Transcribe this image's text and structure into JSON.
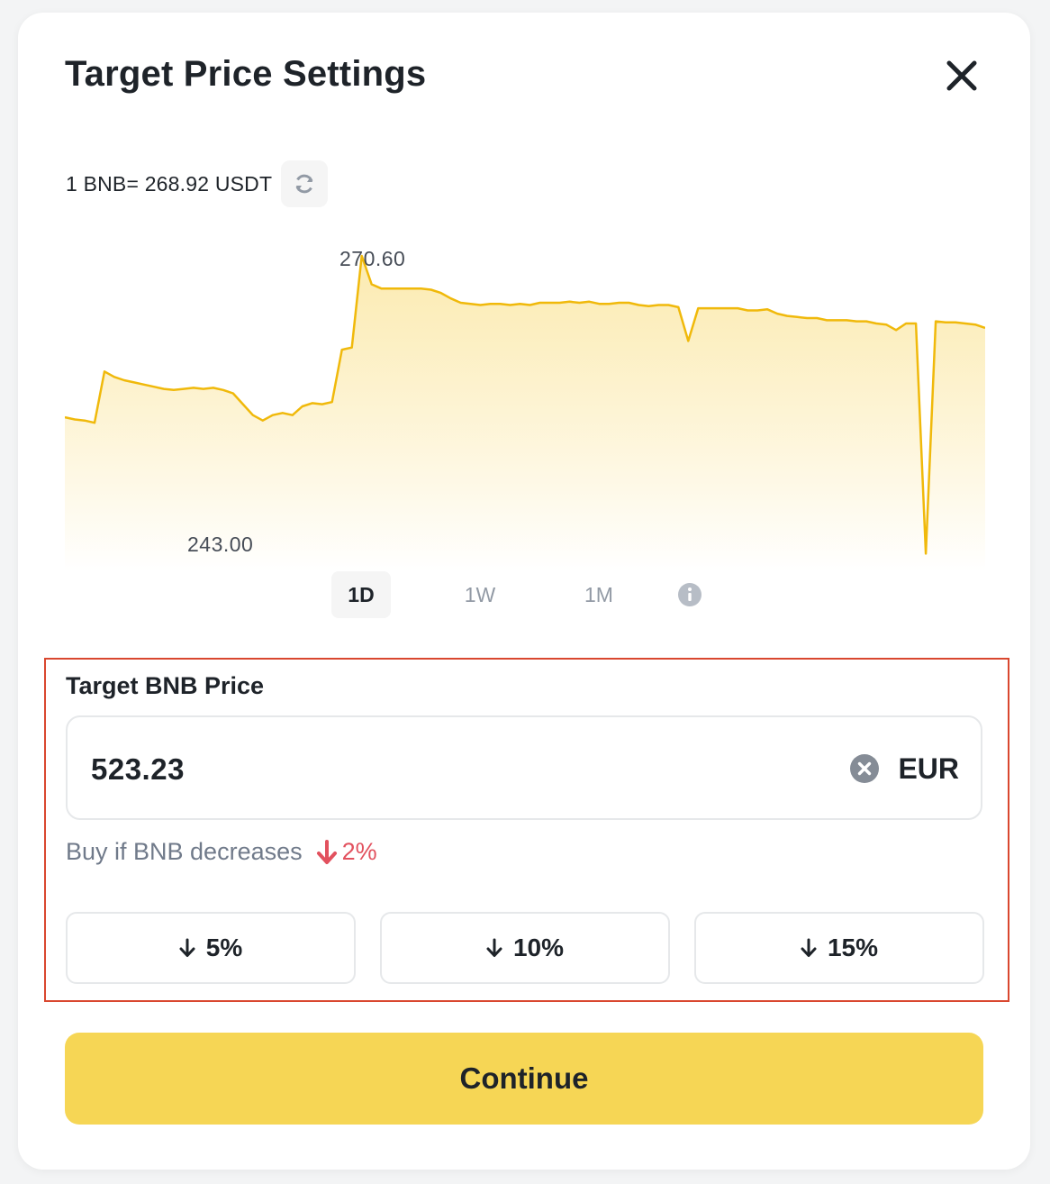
{
  "modal": {
    "title": "Target Price Settings"
  },
  "rate": {
    "text": "1 BNB= 268.92 USDT"
  },
  "chart_data": {
    "type": "area",
    "high_label": "270.60",
    "low_label": "243.00",
    "y_range": [
      243.0,
      270.6
    ],
    "color": "#f0b90b",
    "values": [
      255.8,
      255.6,
      255.5,
      255.3,
      260.0,
      259.5,
      259.2,
      259.0,
      258.8,
      258.6,
      258.4,
      258.3,
      258.4,
      258.5,
      258.4,
      258.5,
      258.3,
      258.0,
      257.0,
      256.0,
      255.5,
      256.0,
      256.2,
      256.0,
      256.8,
      257.1,
      257.0,
      257.2,
      262.0,
      262.2,
      270.6,
      268.0,
      267.6,
      267.6,
      267.6,
      267.6,
      267.6,
      267.5,
      267.2,
      266.7,
      266.3,
      266.2,
      266.1,
      266.2,
      266.2,
      266.1,
      266.2,
      266.1,
      266.3,
      266.3,
      266.3,
      266.4,
      266.3,
      266.4,
      266.2,
      266.2,
      266.3,
      266.3,
      266.1,
      266.0,
      266.1,
      266.1,
      265.9,
      262.8,
      265.8,
      265.8,
      265.8,
      265.8,
      265.8,
      265.6,
      265.6,
      265.7,
      265.3,
      265.1,
      265.0,
      264.9,
      264.9,
      264.7,
      264.7,
      264.7,
      264.6,
      264.6,
      264.4,
      264.3,
      263.8,
      264.4,
      264.4,
      243.3,
      264.6,
      264.5,
      264.5,
      264.4,
      264.3,
      264.0
    ]
  },
  "tabs": [
    {
      "label": "1D",
      "active": true
    },
    {
      "label": "1W",
      "active": false
    },
    {
      "label": "1M",
      "active": false
    }
  ],
  "target": {
    "label": "Target BNB Price",
    "value": "523.23",
    "currency": "EUR",
    "hint_prefix": "Buy if BNB decreases",
    "hint_pct": "2%",
    "hint_color": "#e2515e"
  },
  "presets": [
    {
      "label": "5%"
    },
    {
      "label": "10%"
    },
    {
      "label": "15%"
    }
  ],
  "continue_label": "Continue",
  "colors": {
    "accent": "#f6d655",
    "highlight_border": "#d9472f"
  }
}
